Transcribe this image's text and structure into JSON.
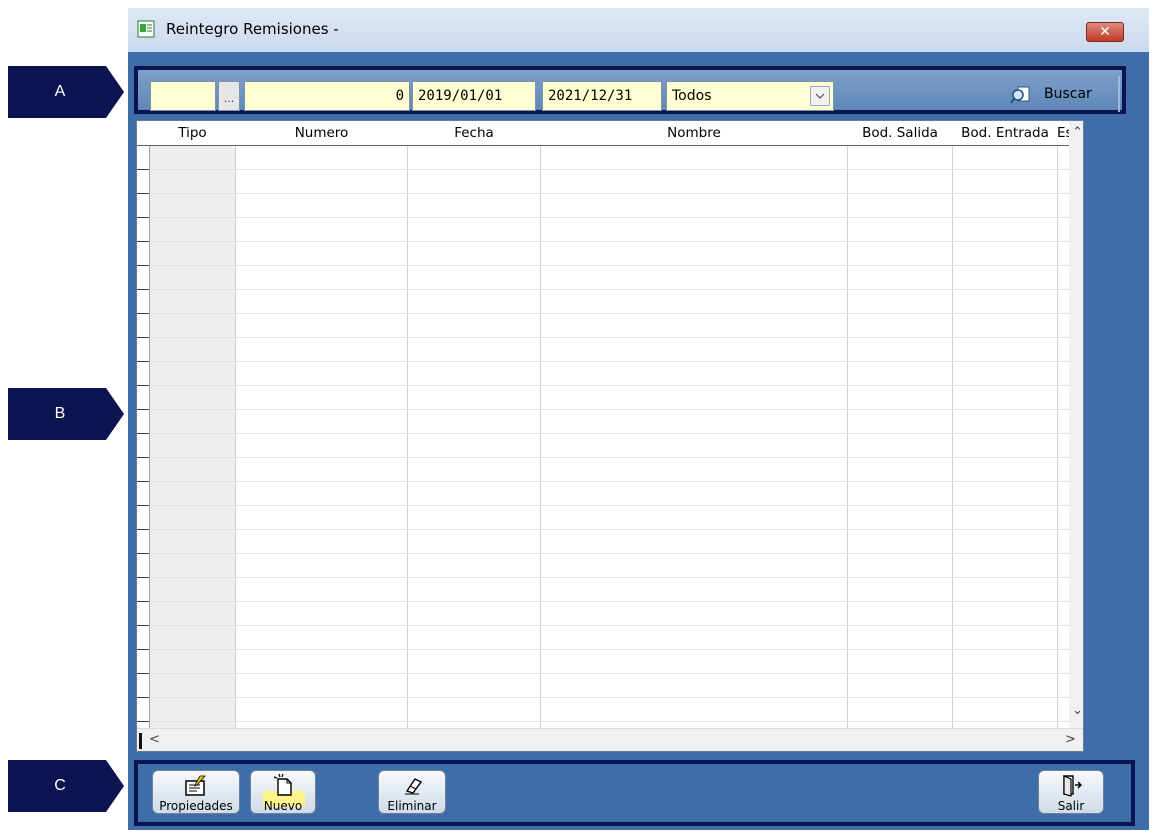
{
  "callouts": {
    "a": "A",
    "b": "B",
    "c": "C",
    "color": "#0a1450"
  },
  "window": {
    "title": "Reintegro Remisiones -",
    "close_icon": "close-x-icon",
    "app_icon": "document-icon"
  },
  "filter": {
    "code_value": "",
    "dots_label": "...",
    "number_value": "0",
    "date_from": "2019/01/01",
    "date_to": "2021/12/31",
    "status_selected": "Todos",
    "search_label": "Buscar",
    "search_icon": "magnifier-document-icon"
  },
  "grid": {
    "columns": [
      "Tipo",
      "Numero",
      "Fecha",
      "Nombre",
      "Bod. Salida",
      "Bod. Entrada",
      "Es"
    ],
    "rows": []
  },
  "toolbar": {
    "properties_label": "Propiedades",
    "new_label": "Nuevo",
    "delete_label": "Eliminar",
    "exit_label": "Salir",
    "field_color": "#fffed2",
    "frame_color": "#3e6da7"
  }
}
